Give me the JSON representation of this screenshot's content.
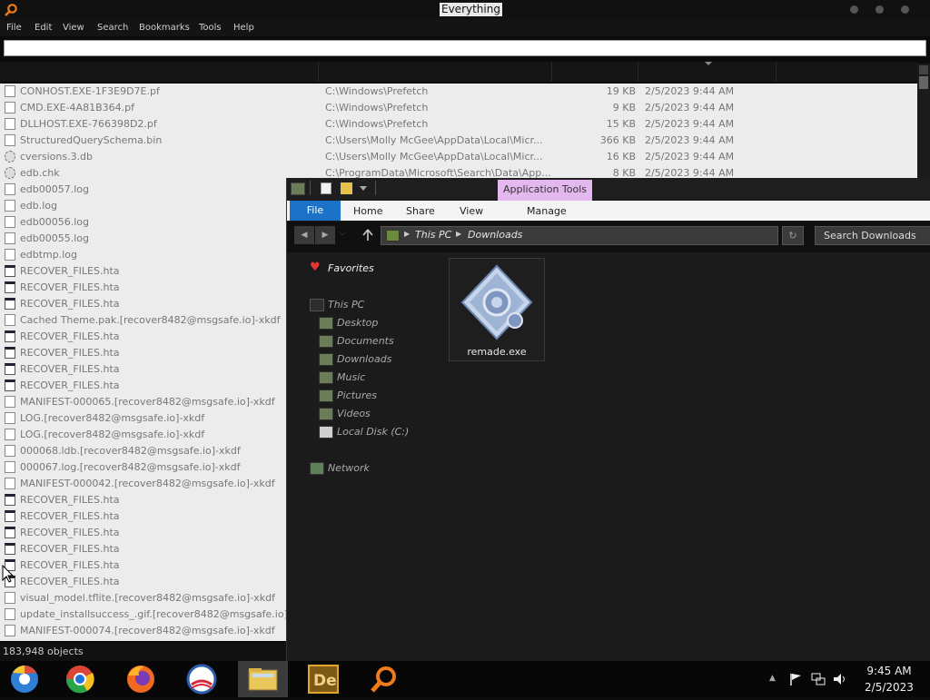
{
  "everything": {
    "title": "Everything",
    "menu": [
      "File",
      "Edit",
      "View",
      "Search",
      "Bookmarks",
      "Tools",
      "Help"
    ],
    "search_value": "",
    "rows": [
      {
        "icon": "file",
        "name": "CONHOST.EXE-1F3E9D7E.pf",
        "path": "C:\\Windows\\Prefetch",
        "size": "19 KB",
        "date": "2/5/2023 9:44 AM"
      },
      {
        "icon": "file",
        "name": "CMD.EXE-4A81B364.pf",
        "path": "C:\\Windows\\Prefetch",
        "size": "9 KB",
        "date": "2/5/2023 9:44 AM"
      },
      {
        "icon": "file",
        "name": "DLLHOST.EXE-766398D2.pf",
        "path": "C:\\Windows\\Prefetch",
        "size": "15 KB",
        "date": "2/5/2023 9:44 AM"
      },
      {
        "icon": "file",
        "name": "StructuredQuerySchema.bin",
        "path": "C:\\Users\\Molly McGee\\AppData\\Local\\Micr...",
        "size": "366 KB",
        "date": "2/5/2023 9:44 AM"
      },
      {
        "icon": "gear",
        "name": "cversions.3.db",
        "path": "C:\\Users\\Molly McGee\\AppData\\Local\\Micr...",
        "size": "16 KB",
        "date": "2/5/2023 9:44 AM"
      },
      {
        "icon": "gear",
        "name": "edb.chk",
        "path": "C:\\ProgramData\\Microsoft\\Search\\Data\\App...",
        "size": "8 KB",
        "date": "2/5/2023 9:44 AM"
      },
      {
        "icon": "file",
        "name": "edb00057.log",
        "path": "",
        "size": "",
        "date": ""
      },
      {
        "icon": "file",
        "name": "edb.log",
        "path": "",
        "size": "",
        "date": ""
      },
      {
        "icon": "file",
        "name": "edb00056.log",
        "path": "",
        "size": "",
        "date": ""
      },
      {
        "icon": "file",
        "name": "edb00055.log",
        "path": "",
        "size": "",
        "date": ""
      },
      {
        "icon": "file",
        "name": "edbtmp.log",
        "path": "",
        "size": "",
        "date": ""
      },
      {
        "icon": "hta",
        "name": "RECOVER_FILES.hta",
        "path": "",
        "size": "",
        "date": ""
      },
      {
        "icon": "hta",
        "name": "RECOVER_FILES.hta",
        "path": "",
        "size": "",
        "date": ""
      },
      {
        "icon": "hta",
        "name": "RECOVER_FILES.hta",
        "path": "",
        "size": "",
        "date": ""
      },
      {
        "icon": "file",
        "name": "Cached Theme.pak.[recover8482@msgsafe.io]-xkdf",
        "path": "",
        "size": "",
        "date": ""
      },
      {
        "icon": "hta",
        "name": "RECOVER_FILES.hta",
        "path": "",
        "size": "",
        "date": ""
      },
      {
        "icon": "hta",
        "name": "RECOVER_FILES.hta",
        "path": "",
        "size": "",
        "date": ""
      },
      {
        "icon": "hta",
        "name": "RECOVER_FILES.hta",
        "path": "",
        "size": "",
        "date": ""
      },
      {
        "icon": "hta",
        "name": "RECOVER_FILES.hta",
        "path": "",
        "size": "",
        "date": ""
      },
      {
        "icon": "file",
        "name": "MANIFEST-000065.[recover8482@msgsafe.io]-xkdf",
        "path": "",
        "size": "",
        "date": ""
      },
      {
        "icon": "file",
        "name": "LOG.[recover8482@msgsafe.io]-xkdf",
        "path": "",
        "size": "",
        "date": ""
      },
      {
        "icon": "file",
        "name": "LOG.[recover8482@msgsafe.io]-xkdf",
        "path": "",
        "size": "",
        "date": ""
      },
      {
        "icon": "file",
        "name": "000068.ldb.[recover8482@msgsafe.io]-xkdf",
        "path": "",
        "size": "",
        "date": ""
      },
      {
        "icon": "file",
        "name": "000067.log.[recover8482@msgsafe.io]-xkdf",
        "path": "",
        "size": "",
        "date": ""
      },
      {
        "icon": "file",
        "name": "MANIFEST-000042.[recover8482@msgsafe.io]-xkdf",
        "path": "",
        "size": "",
        "date": ""
      },
      {
        "icon": "hta",
        "name": "RECOVER_FILES.hta",
        "path": "",
        "size": "",
        "date": ""
      },
      {
        "icon": "hta",
        "name": "RECOVER_FILES.hta",
        "path": "",
        "size": "",
        "date": ""
      },
      {
        "icon": "hta",
        "name": "RECOVER_FILES.hta",
        "path": "",
        "size": "",
        "date": ""
      },
      {
        "icon": "hta",
        "name": "RECOVER_FILES.hta",
        "path": "",
        "size": "",
        "date": ""
      },
      {
        "icon": "hta",
        "name": "RECOVER_FILES.hta",
        "path": "",
        "size": "",
        "date": ""
      },
      {
        "icon": "hta",
        "name": "RECOVER_FILES.hta",
        "path": "",
        "size": "",
        "date": ""
      },
      {
        "icon": "file",
        "name": "visual_model.tflite.[recover8482@msgsafe.io]-xkdf",
        "path": "",
        "size": "",
        "date": ""
      },
      {
        "icon": "file",
        "name": "update_installsuccess_.gif.[recover8482@msgsafe.io]-xkdf",
        "path": "",
        "size": "",
        "date": ""
      },
      {
        "icon": "file",
        "name": "MANIFEST-000074.[recover8482@msgsafe.io]-xkdf",
        "path": "",
        "size": "",
        "date": ""
      }
    ],
    "status": "183,948 objects"
  },
  "explorer": {
    "context_tab": "Application Tools",
    "ribbon": {
      "file": "File",
      "home": "Home",
      "share": "Share",
      "view": "View",
      "manage": "Manage"
    },
    "breadcrumb": [
      "This PC",
      "Downloads"
    ],
    "search_placeholder": "Search Downloads",
    "nav": {
      "favorites": "Favorites",
      "this_pc": "This PC",
      "items": [
        "Desktop",
        "Documents",
        "Downloads",
        "Music",
        "Pictures",
        "Videos",
        "Local Disk (C:)"
      ],
      "network": "Network"
    },
    "files": [
      {
        "name": "remade.exe",
        "icon": "generic-executable-icon"
      }
    ]
  },
  "taskbar": {
    "apps": [
      "chromium-icon",
      "chrome-icon",
      "firefox-icon",
      "obama-campaign-icon",
      "file-explorer-icon",
      "dreamweaver-icon",
      "everything-search-icon"
    ],
    "time": "9:45 AM",
    "date": "2/5/2023"
  },
  "colors": {
    "accent_blue": "#1c71c9",
    "app_tools_tab": "#e3b8ef",
    "list_bg": "#ececec"
  }
}
